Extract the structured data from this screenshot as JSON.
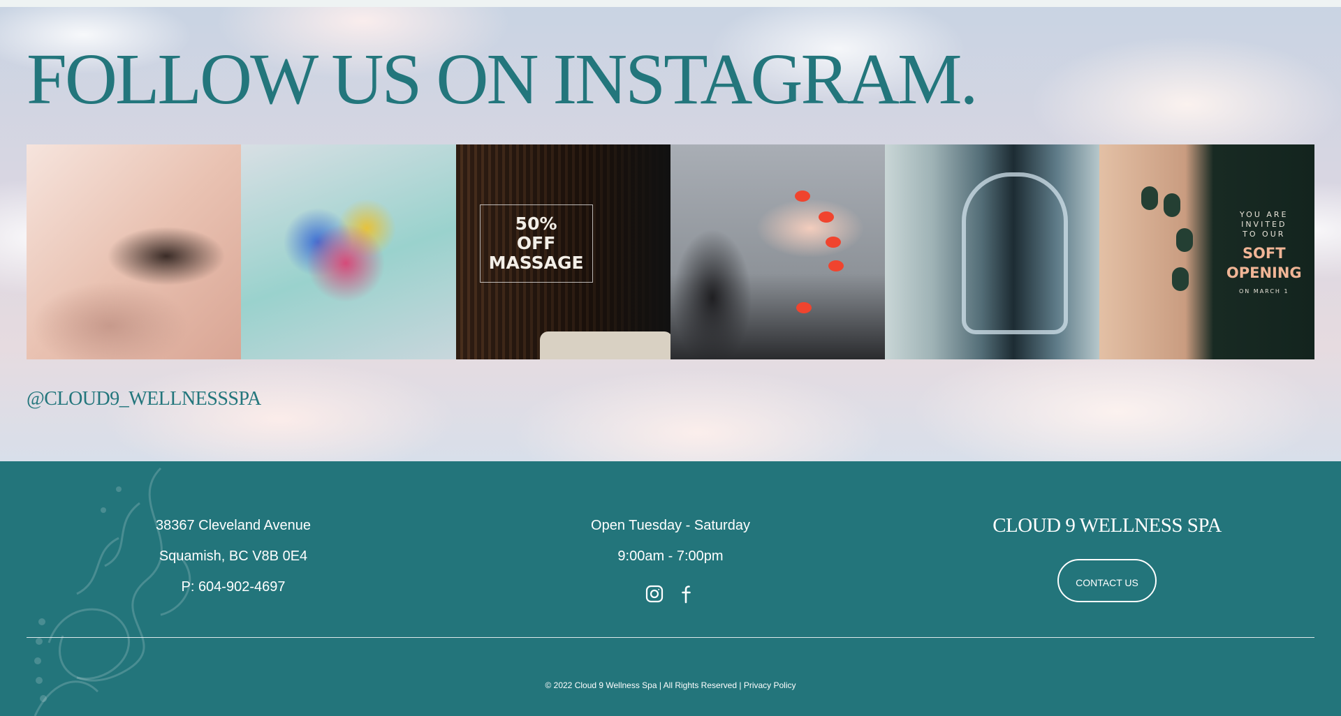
{
  "instagram": {
    "title": "FOLLOW US ON INSTAGRAM.",
    "handle": "@CLOUD9_WELLNESSSPA",
    "tiles": [
      {
        "subject": "eyelash extension close-up"
      },
      {
        "subject": "nail color swatches cup"
      },
      {
        "subject": "massage room promo",
        "overlay_text": "50%\nOFF\nMASSAGE"
      },
      {
        "subject": "hand with orange nail polish"
      },
      {
        "subject": "clear acrylic chair"
      },
      {
        "subject": "soft opening invite",
        "overlay_small": "YOU ARE INVITED TO OUR",
        "overlay_big": "SOFT\nOPENING",
        "overlay_date": "ON MARCH 1"
      }
    ]
  },
  "footer": {
    "address_line1": "38367 Cleveland Avenue",
    "address_line2": "Squamish, BC V8B 0E4",
    "phone": "P: 604-902-4697",
    "hours_days": "Open Tuesday - Saturday",
    "hours_time": "9:00am - 7:00pm",
    "social_icons": [
      "instagram-icon",
      "facebook-icon"
    ],
    "brand": "CLOUD 9 WELLNESS SPA",
    "contact_label": "CONTACT US",
    "copyright": "© 2022 Cloud 9 Wellness Spa | All Rights Reserved |",
    "privacy_label": "Privacy Policy"
  },
  "colors": {
    "teal": "#23757b",
    "title_teal": "#23767c",
    "white": "#ffffff"
  }
}
